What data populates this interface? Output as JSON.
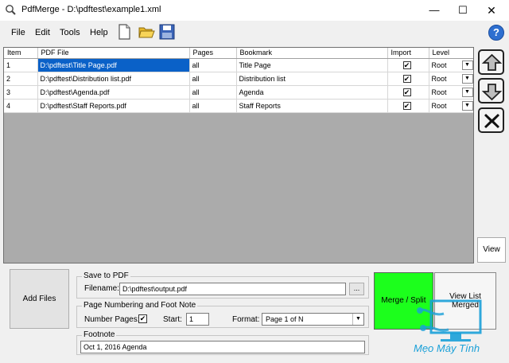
{
  "window": {
    "title": "PdfMerge - D:\\pdftest\\example1.xml",
    "min": "—",
    "max": "☐",
    "close": "✕"
  },
  "menu": {
    "items": [
      "File",
      "Edit",
      "Tools",
      "Help"
    ]
  },
  "help_glyph": "?",
  "grid": {
    "columns": [
      "Item",
      "PDF File",
      "Pages",
      "Bookmark",
      "Import",
      "Level"
    ],
    "rows": [
      {
        "item": "1",
        "file": "D:\\pdftest\\Title Page.pdf",
        "pages": "all",
        "bookmark": "Title Page",
        "import": true,
        "level": "Root"
      },
      {
        "item": "2",
        "file": "D:\\pdftest\\Distribution list.pdf",
        "pages": "all",
        "bookmark": "Distribution list",
        "import": true,
        "level": "Root"
      },
      {
        "item": "3",
        "file": "D:\\pdftest\\Agenda.pdf",
        "pages": "all",
        "bookmark": "Agenda",
        "import": true,
        "level": "Root"
      },
      {
        "item": "4",
        "file": "D:\\pdftest\\Staff Reports.pdf",
        "pages": "all",
        "bookmark": "Staff Reports",
        "import": true,
        "level": "Root"
      }
    ],
    "selected_row": 0,
    "check_glyph": "✔",
    "dropdown_glyph": "▼"
  },
  "side": {
    "view_label": "View"
  },
  "add_files_label": "Add Files",
  "save": {
    "group_label": "Save to PDF",
    "filename_label": "Filename:",
    "filename_value": "D:\\pdftest\\output.pdf",
    "browse_label": "..."
  },
  "numbering": {
    "group_label": "Page Numbering and Foot Note",
    "number_pages_label": "Number Pages:",
    "number_pages_checked": true,
    "start_label": "Start:",
    "start_value": "1",
    "format_label": "Format:",
    "format_value": "Page 1 of N"
  },
  "footnote": {
    "group_label": "Footnote",
    "value": "Oct 1, 2016 Agenda"
  },
  "merge_label": "Merge / Split",
  "viewlist_label": "View List Merged",
  "watermark_text": "Mẹo Máy Tính",
  "colors": {
    "selection": "#0a61c8",
    "merge_button": "#1cff1c",
    "grid_background": "#ababab",
    "watermark": "#1aa0d8"
  }
}
